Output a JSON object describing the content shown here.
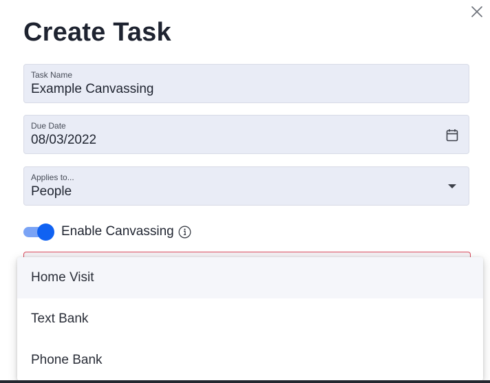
{
  "dialog": {
    "title": "Create Task",
    "close_icon": "close-icon"
  },
  "fields": {
    "task_name": {
      "label": "Task Name",
      "value": "Example Canvassing"
    },
    "due_date": {
      "label": "Due Date",
      "value": "08/03/2022",
      "icon": "calendar-icon"
    },
    "applies_to": {
      "label": "Applies to...",
      "value": "People",
      "icon": "dropdown-arrow-icon"
    }
  },
  "canvassing_toggle": {
    "label": "Enable Canvassing",
    "enabled": true,
    "info_icon": "info-icon"
  },
  "canvass_type_menu": {
    "options": [
      "Home Visit",
      "Text Bank",
      "Phone Bank"
    ],
    "highlighted_option": "Home Visit"
  },
  "colors": {
    "field_background": "#e9ecf6",
    "toggle_accent": "#1062f2",
    "error_border": "#d9485a"
  }
}
